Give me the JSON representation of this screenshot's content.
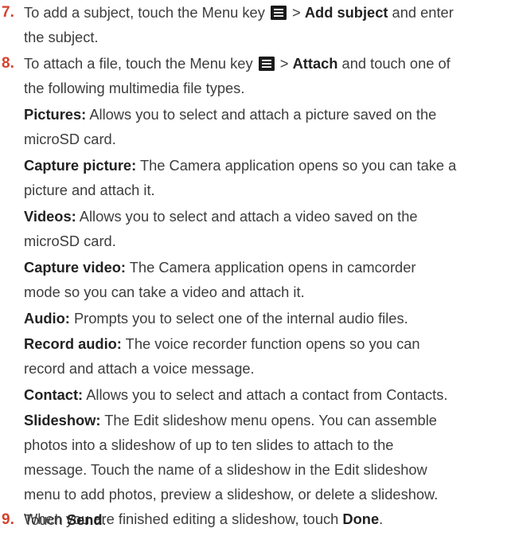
{
  "colors": {
    "accent": "#d5412e",
    "text": "#3d3d3d",
    "icon": "#1a1a1a"
  },
  "icons": {
    "menu_key": "menu-key-icon"
  },
  "step7": {
    "number": "7.",
    "l1_a": "To add a subject, touch the Menu key",
    "l1_sep": ">",
    "l1_bold": "Add subject",
    "l1_b": "and enter",
    "l2": "the subject."
  },
  "step8": {
    "number": "8.",
    "l1_a": "To attach a file, touch the Menu key",
    "l1_sep": ">",
    "l1_bold": "Attach",
    "l1_b": "and touch one of",
    "l2": "the following multimedia file types.",
    "items": [
      {
        "term": "Pictures:",
        "lines": [
          "Allows you to select and attach a picture saved on the",
          "microSD card."
        ]
      },
      {
        "term": "Capture picture:",
        "lines": [
          "The Camera application opens so you can take a",
          "picture and attach it."
        ]
      },
      {
        "term": "Videos:",
        "lines": [
          "Allows you to select and attach a video saved on the",
          "microSD card."
        ]
      },
      {
        "term": "Capture video:",
        "lines": [
          "The Camera application opens in camcorder",
          "mode so you can take a video and attach it."
        ]
      },
      {
        "term": "Audio:",
        "lines": [
          "Prompts you to select one of the internal audio files."
        ]
      },
      {
        "term": "Record audio:",
        "lines": [
          "The voice recorder function opens so you can",
          "record and attach a voice message."
        ]
      },
      {
        "term": "Contact:",
        "lines": [
          "Allows you to select and attach a contact from Contacts."
        ]
      },
      {
        "term": "Slideshow:",
        "lines": [
          "The Edit slideshow menu opens. You can assemble",
          "photos into a slideshow of up to ten slides to attach to the",
          "message. Touch the name of a slideshow in the Edit slideshow",
          "menu to add photos, preview a slideshow, or delete a slideshow.",
          "When you are finished editing a slideshow, touch"
        ],
        "tail_bold": "Done",
        "tail_end": "."
      }
    ]
  },
  "step9": {
    "number": "9.",
    "text": "Touch",
    "bold": "Send",
    "end": "."
  }
}
